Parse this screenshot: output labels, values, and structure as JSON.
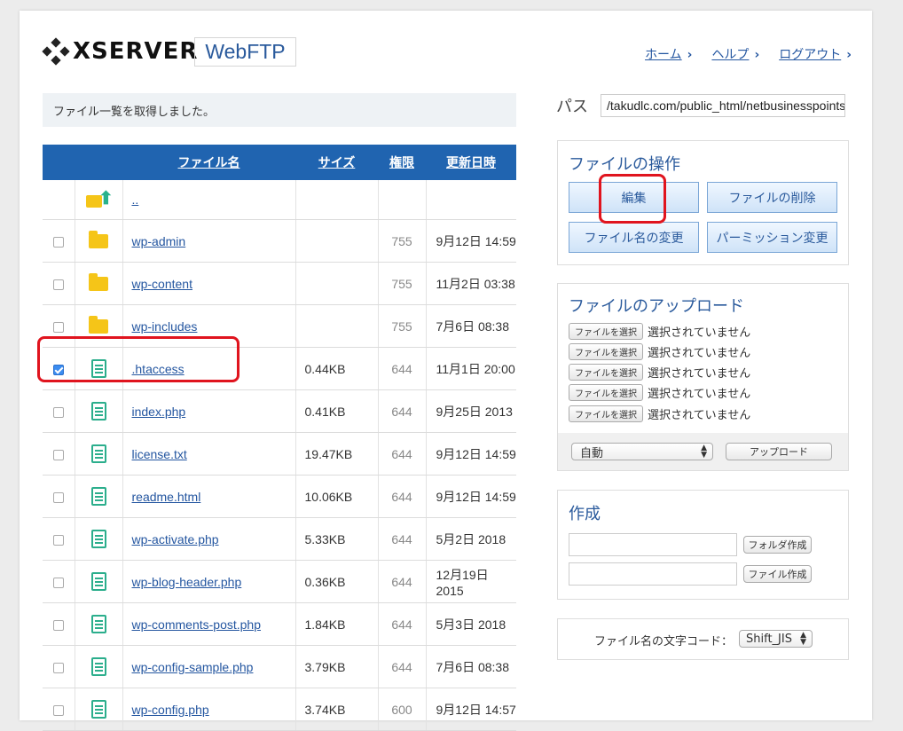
{
  "header": {
    "logo_text": "XSERVER",
    "product": "WebFTP",
    "nav": [
      {
        "label": "ホーム"
      },
      {
        "label": "ヘルプ"
      },
      {
        "label": "ログアウト"
      }
    ]
  },
  "message": "ファイル一覧を取得しました。",
  "table": {
    "headers": {
      "name": "ファイル名",
      "size": "サイズ",
      "perm": "権限",
      "date": "更新日時"
    },
    "parent": "..",
    "rows": [
      {
        "type": "folder",
        "name": "wp-admin",
        "size": "",
        "perm": "755",
        "date": "9月12日 14:59",
        "checked": false
      },
      {
        "type": "folder",
        "name": "wp-content",
        "size": "",
        "perm": "755",
        "date": "11月2日 03:38",
        "checked": false
      },
      {
        "type": "folder",
        "name": "wp-includes",
        "size": "",
        "perm": "755",
        "date": "7月6日 08:38",
        "checked": false
      },
      {
        "type": "file",
        "name": ".htaccess",
        "size": "0.44KB",
        "perm": "644",
        "date": "11月1日 20:00",
        "checked": true
      },
      {
        "type": "file",
        "name": "index.php",
        "size": "0.41KB",
        "perm": "644",
        "date": "9月25日 2013",
        "checked": false
      },
      {
        "type": "file",
        "name": "license.txt",
        "size": "19.47KB",
        "perm": "644",
        "date": "9月12日 14:59",
        "checked": false
      },
      {
        "type": "file",
        "name": "readme.html",
        "size": "10.06KB",
        "perm": "644",
        "date": "9月12日 14:59",
        "checked": false
      },
      {
        "type": "file",
        "name": "wp-activate.php",
        "size": "5.33KB",
        "perm": "644",
        "date": "5月2日 2018",
        "checked": false
      },
      {
        "type": "file",
        "name": "wp-blog-header.php",
        "size": "0.36KB",
        "perm": "644",
        "date": "12月19日 2015",
        "checked": false
      },
      {
        "type": "file",
        "name": "wp-comments-post.php",
        "size": "1.84KB",
        "perm": "644",
        "date": "5月3日 2018",
        "checked": false
      },
      {
        "type": "file",
        "name": "wp-config-sample.php",
        "size": "3.79KB",
        "perm": "644",
        "date": "7月6日 08:38",
        "checked": false
      },
      {
        "type": "file",
        "name": "wp-config.php",
        "size": "3.74KB",
        "perm": "600",
        "date": "9月12日 14:57",
        "checked": false
      }
    ]
  },
  "path": {
    "label": "パス",
    "value": "/takudlc.com/public_html/netbusinesspoints"
  },
  "file_ops": {
    "title": "ファイルの操作",
    "edit": "編集",
    "delete": "ファイルの削除",
    "rename": "ファイル名の変更",
    "permission": "パーミッション変更"
  },
  "upload": {
    "title": "ファイルのアップロード",
    "choose_label": "ファイルを選択",
    "none_label": "選択されていません",
    "mode": "自動",
    "upload_button": "アップロード"
  },
  "create": {
    "title": "作成",
    "folder_button": "フォルダ作成",
    "file_button": "ファイル作成"
  },
  "encoding": {
    "label": "ファイル名の文字コード：",
    "value": "Shift_JIS"
  },
  "colors": {
    "accent": "#2064b0",
    "highlight": "#e0141e",
    "file_icon": "#2bae8c",
    "folder_icon": "#f5c518"
  }
}
